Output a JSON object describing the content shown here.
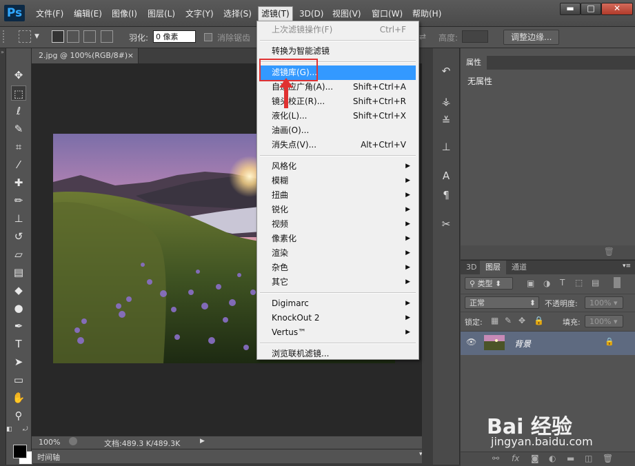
{
  "app": {
    "logo": "Ps"
  },
  "menubar": {
    "items": [
      "文件(F)",
      "编辑(E)",
      "图像(I)",
      "图层(L)",
      "文字(Y)",
      "选择(S)",
      "滤镜(T)",
      "3D(D)",
      "视图(V)",
      "窗口(W)",
      "帮助(H)"
    ],
    "active_index": 6
  },
  "window_controls": {
    "minimize": "▬",
    "maximize": "□",
    "close": "✕"
  },
  "options": {
    "feather_label": "羽化:",
    "feather_value": "0 像素",
    "antialias_label": "消除锯齿",
    "height_label": "高度:",
    "refine_edge_button": "调整边缘..."
  },
  "document": {
    "tab_title": "2.jpg @ 100%(RGB/8#)",
    "tab_close": "×",
    "zoom": "100%",
    "doc_info": "文档:489.3 K/489.3K"
  },
  "timeline": {
    "label": "时间轴"
  },
  "filter_menu": {
    "items": [
      {
        "label": "上次滤镜操作(F)",
        "shortcut": "Ctrl+F",
        "disabled": true
      },
      {
        "sep": true
      },
      {
        "label": "转换为智能滤镜",
        "shortcut": ""
      },
      {
        "sep": true
      },
      {
        "label": "滤镜库(G)...",
        "shortcut": "",
        "highlighted": true
      },
      {
        "label": "自适应广角(A)...",
        "shortcut": "Shift+Ctrl+A"
      },
      {
        "label": "镜头校正(R)...",
        "shortcut": "Shift+Ctrl+R"
      },
      {
        "label": "液化(L)...",
        "shortcut": "Shift+Ctrl+X"
      },
      {
        "label": "油画(O)...",
        "shortcut": ""
      },
      {
        "label": "消失点(V)...",
        "shortcut": "Alt+Ctrl+V"
      },
      {
        "sep": true
      },
      {
        "label": "风格化",
        "submenu": true
      },
      {
        "label": "模糊",
        "submenu": true
      },
      {
        "label": "扭曲",
        "submenu": true
      },
      {
        "label": "锐化",
        "submenu": true
      },
      {
        "label": "视频",
        "submenu": true
      },
      {
        "label": "像素化",
        "submenu": true
      },
      {
        "label": "渲染",
        "submenu": true
      },
      {
        "label": "杂色",
        "submenu": true
      },
      {
        "label": "其它",
        "submenu": true
      },
      {
        "sep": true
      },
      {
        "label": "Digimarc",
        "submenu": true
      },
      {
        "label": "KnockOut 2",
        "submenu": true
      },
      {
        "label": "Vertus™",
        "submenu": true
      },
      {
        "sep": true
      },
      {
        "label": "浏览联机滤镜...",
        "shortcut": ""
      }
    ]
  },
  "properties_panel": {
    "tab": "属性",
    "empty_text": "无属性"
  },
  "layers_panel": {
    "tabs": [
      "3D",
      "图层",
      "通道"
    ],
    "active_tab": 1,
    "filter_kind": "类型",
    "blend_mode": "正常",
    "opacity_label": "不透明度:",
    "opacity_value": "100%",
    "lock_label": "锁定:",
    "fill_label": "填充:",
    "fill_value": "100%",
    "layer_name": "背景"
  },
  "watermark": {
    "brand": "Bai 经验",
    "url": "jingyan.baidu.com"
  }
}
